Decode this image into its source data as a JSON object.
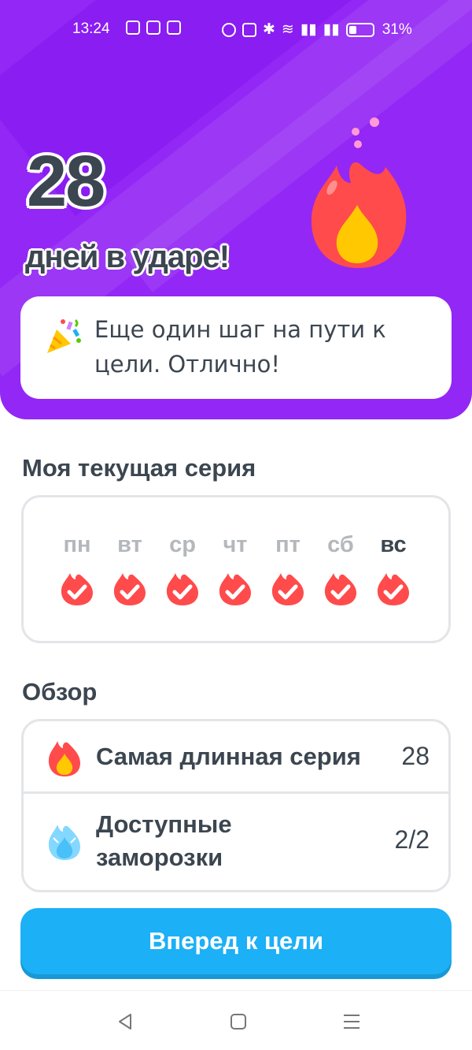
{
  "status_bar": {
    "time": "13:24",
    "battery_percent": "31%"
  },
  "streak": {
    "count": "28",
    "label": "дней в ударе!"
  },
  "message": {
    "text": "Еще один шаг на пути к цели. Отлично!"
  },
  "current_streak": {
    "title": "Моя текущая серия",
    "days": [
      {
        "label": "пн",
        "completed": true,
        "today": false
      },
      {
        "label": "вт",
        "completed": true,
        "today": false
      },
      {
        "label": "ср",
        "completed": true,
        "today": false
      },
      {
        "label": "чт",
        "completed": true,
        "today": false
      },
      {
        "label": "пт",
        "completed": true,
        "today": false
      },
      {
        "label": "сб",
        "completed": true,
        "today": false
      },
      {
        "label": "вс",
        "completed": true,
        "today": true
      }
    ]
  },
  "overview": {
    "title": "Обзор",
    "longest_streak_label": "Самая длинная серия",
    "longest_streak_value": "28",
    "freezes_label": "Доступные заморозки",
    "freezes_value": "2/2"
  },
  "cta": {
    "label": "Вперед к цели"
  },
  "colors": {
    "hero_bg": "#9327f5",
    "flame_red": "#ff4b4b",
    "flame_yellow": "#ffc800",
    "button_blue": "#1cb0f6",
    "freeze_blue": "#84d8ff"
  },
  "icons": {
    "hero": "fire-icon",
    "message": "party-popper-icon",
    "day_mark": "flame-check-icon",
    "longest": "fire-icon",
    "freeze": "ice-flame-icon"
  }
}
